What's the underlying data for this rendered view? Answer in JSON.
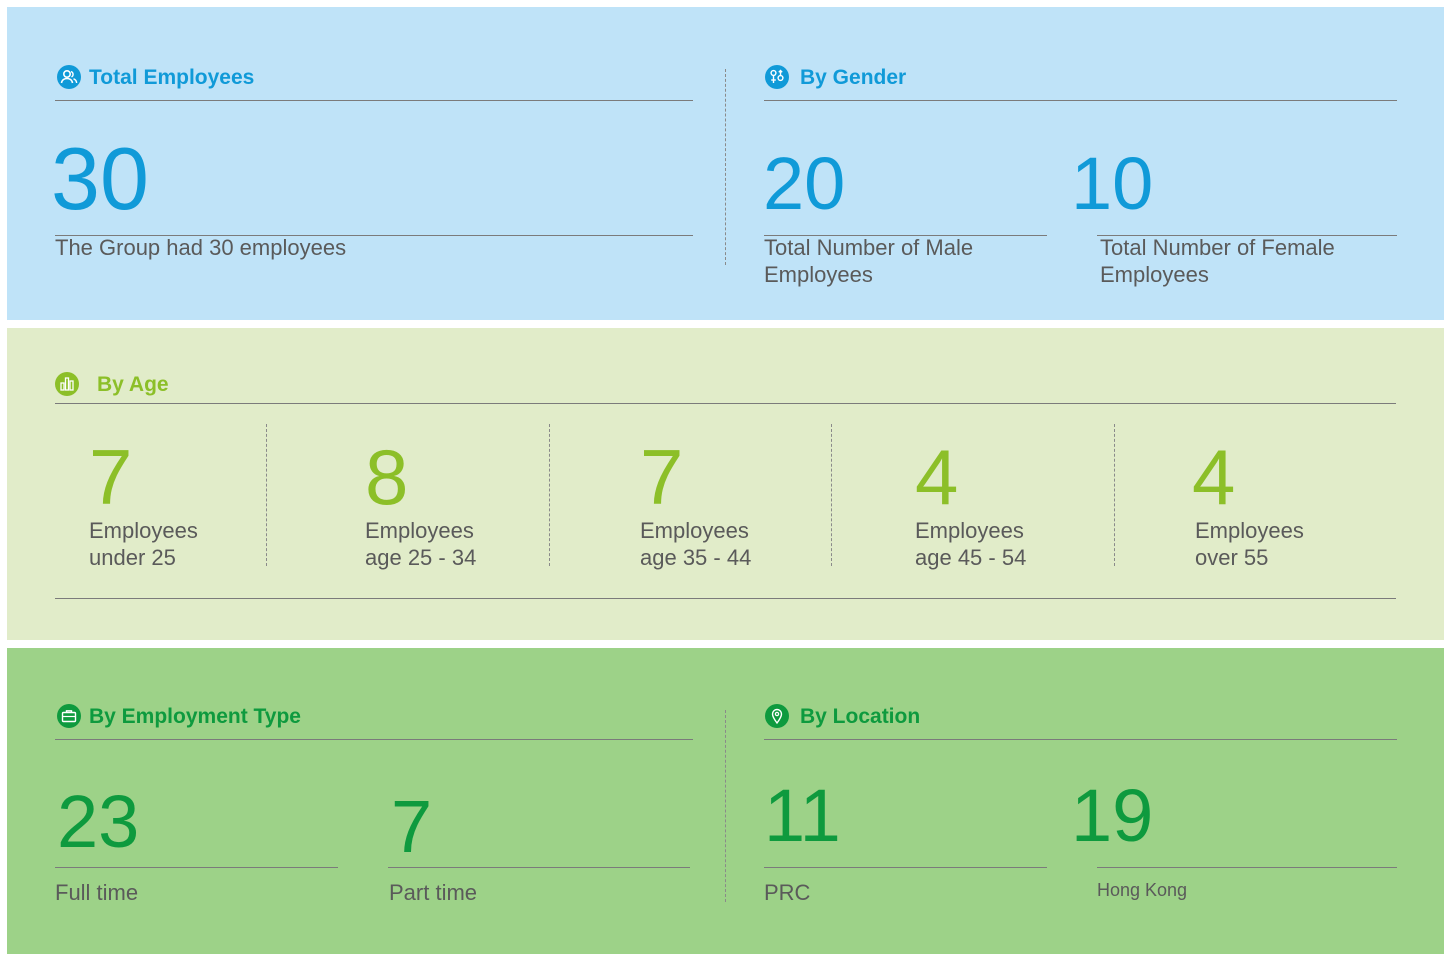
{
  "total": {
    "title": "Total Employees",
    "icon": "people-icon",
    "value": "30",
    "caption": "The Group had 30 employees"
  },
  "gender": {
    "title": "By Gender",
    "icon": "gender-icon",
    "male_value": "20",
    "male_line1": "Total Number of Male",
    "male_line2": "Employees",
    "female_value": "10",
    "female_line1": "Total Number of Female",
    "female_line2": "Employees"
  },
  "age": {
    "title": "By Age",
    "icon": "bar-chart-icon",
    "groups": [
      {
        "value": "7",
        "line1": "Employees",
        "line2": "under 25"
      },
      {
        "value": "8",
        "line1": "Employees",
        "line2": "age 25 - 34"
      },
      {
        "value": "7",
        "line1": "Employees",
        "line2": "age 35 - 44"
      },
      {
        "value": "4",
        "line1": "Employees",
        "line2": "age 45 - 54"
      },
      {
        "value": "4",
        "line1": "Employees",
        "line2": "over 55"
      }
    ]
  },
  "employment": {
    "title": "By Employment Type",
    "icon": "briefcase-icon",
    "full_value": "23",
    "full_label": "Full time",
    "part_value": "7",
    "part_label": "Part time"
  },
  "location": {
    "title": "By Location",
    "icon": "location-pin-icon",
    "prc_value": "11",
    "prc_label": "PRC",
    "hk_value": "19",
    "hk_label": "Hong Kong"
  },
  "colors": {
    "panel_top": "#bfe3f8",
    "panel_middle": "#e1ecc9",
    "panel_bottom": "#9dd288",
    "accent_blue": "#109ad8",
    "accent_light_green": "#8cbf28",
    "accent_dark_green": "#0e9a3e"
  }
}
